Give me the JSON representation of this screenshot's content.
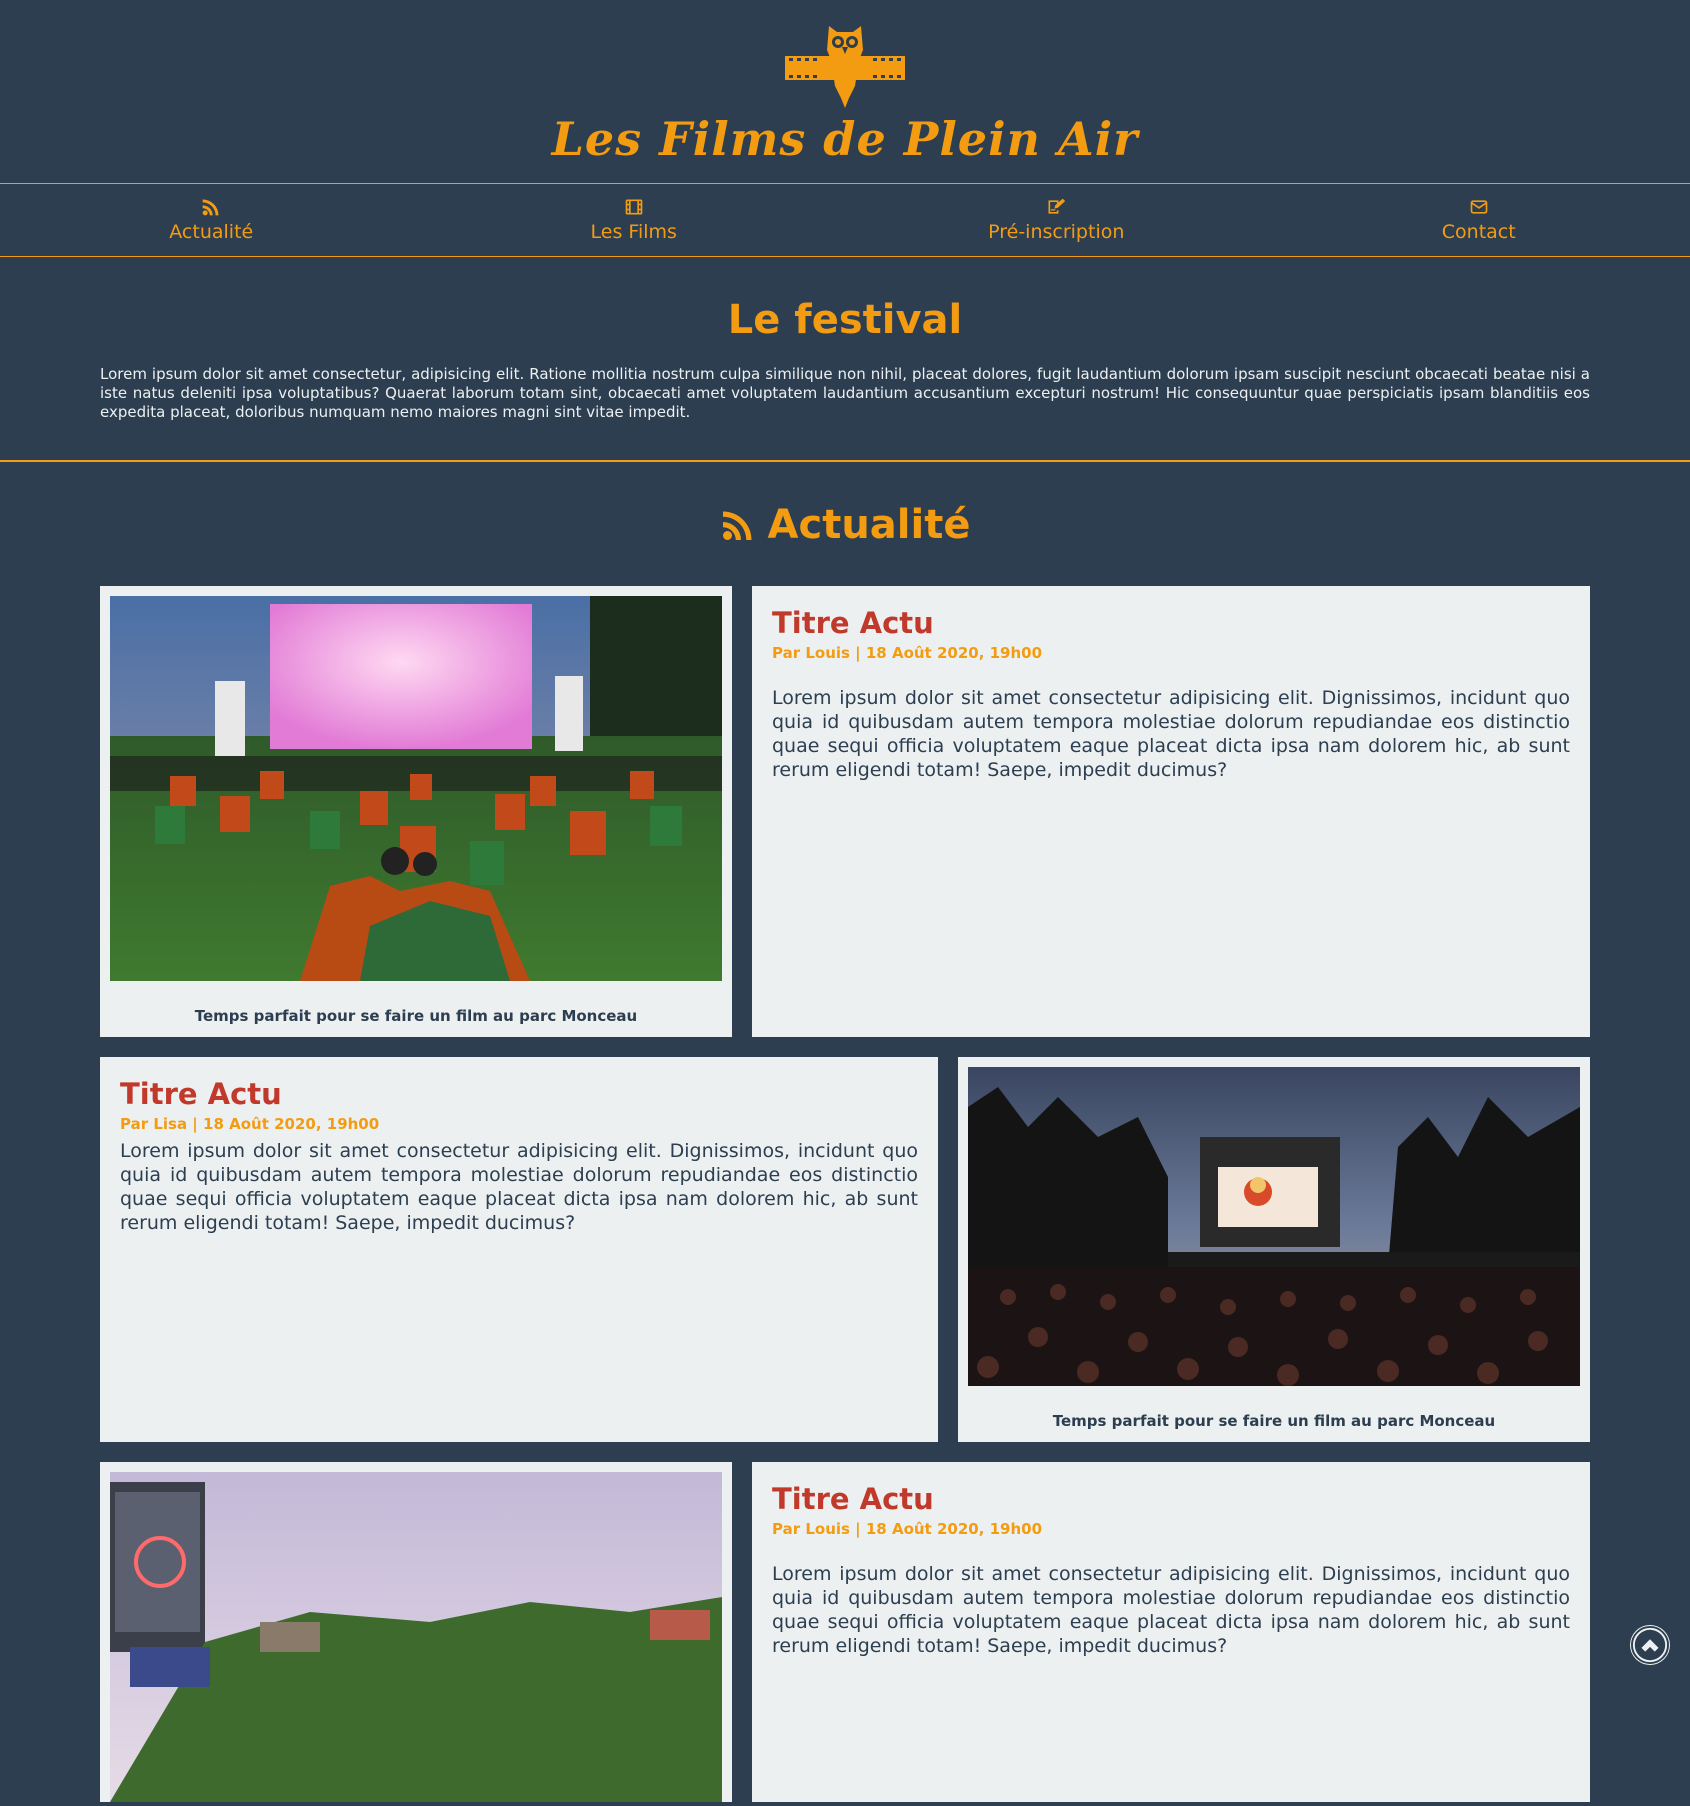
{
  "header": {
    "title": "Les Films de Plein Air"
  },
  "nav": [
    {
      "icon": "rss-icon",
      "label": "Actualité"
    },
    {
      "icon": "film-icon",
      "label": "Les Films"
    },
    {
      "icon": "signature-icon",
      "label": "Pré-inscription"
    },
    {
      "icon": "envelope-icon",
      "label": "Contact"
    }
  ],
  "festival": {
    "heading": "Le festival",
    "text": "Lorem ipsum dolor sit amet consectetur, adipisicing elit. Ratione mollitia nostrum culpa similique non nihil, placeat dolores, fugit laudantium dolorum ipsam suscipit nesciunt obcaecati beatae nisi a iste natus deleniti ipsa voluptatibus? Quaerat laborum totam sint, obcaecati amet voluptatem laudantium accusantium excepturi nostrum! Hic consequuntur quae perspiciatis ipsam blanditiis eos expedita placeat, doloribus numquam nemo maiores magni sint vitae impedit."
  },
  "actualite": {
    "heading": "Actualité",
    "articles": [
      {
        "title": "Titre Actu",
        "meta": "Par Louis | 18 Août 2020, 19h00",
        "text": "Lorem ipsum dolor sit amet consectetur adipisicing elit. Dignissimos, incidunt quo quia id quibusdam autem tempora molestiae dolorum repudiandae eos distinctio quae sequi officia voluptatem eaque placeat dicta ipsa nam dolorem hic, ab sunt rerum eligendi totam! Saepe, impedit ducimus?",
        "caption": "Temps parfait pour se faire un film au parc Monceau"
      },
      {
        "title": "Titre Actu",
        "meta": "Par Lisa | 18 Août 2020, 19h00",
        "text": "Lorem ipsum dolor sit amet consectetur adipisicing elit. Dignissimos, incidunt quo quia id quibusdam autem tempora molestiae dolorum repudiandae eos distinctio quae sequi officia voluptatem eaque placeat dicta ipsa nam dolorem hic, ab sunt rerum eligendi totam! Saepe, impedit ducimus?",
        "caption": "Temps parfait pour se faire un film au parc Monceau"
      },
      {
        "title": "Titre Actu",
        "meta": "Par Louis | 18 Août 2020, 19h00",
        "text": "Lorem ipsum dolor sit amet consectetur adipisicing elit. Dignissimos, incidunt quo quia id quibusdam autem tempora molestiae dolorum repudiandae eos distinctio quae sequi officia voluptatem eaque placeat dicta ipsa nam dolorem hic, ab sunt rerum eligendi totam! Saepe, impedit ducimus?"
      }
    ]
  },
  "colors": {
    "background": "#2c3e50",
    "accent": "#f39c12",
    "card": "#ecf0f1",
    "title_red": "#c0392b"
  },
  "scroll_top": {
    "icon": "chevron-up-circle-icon"
  }
}
